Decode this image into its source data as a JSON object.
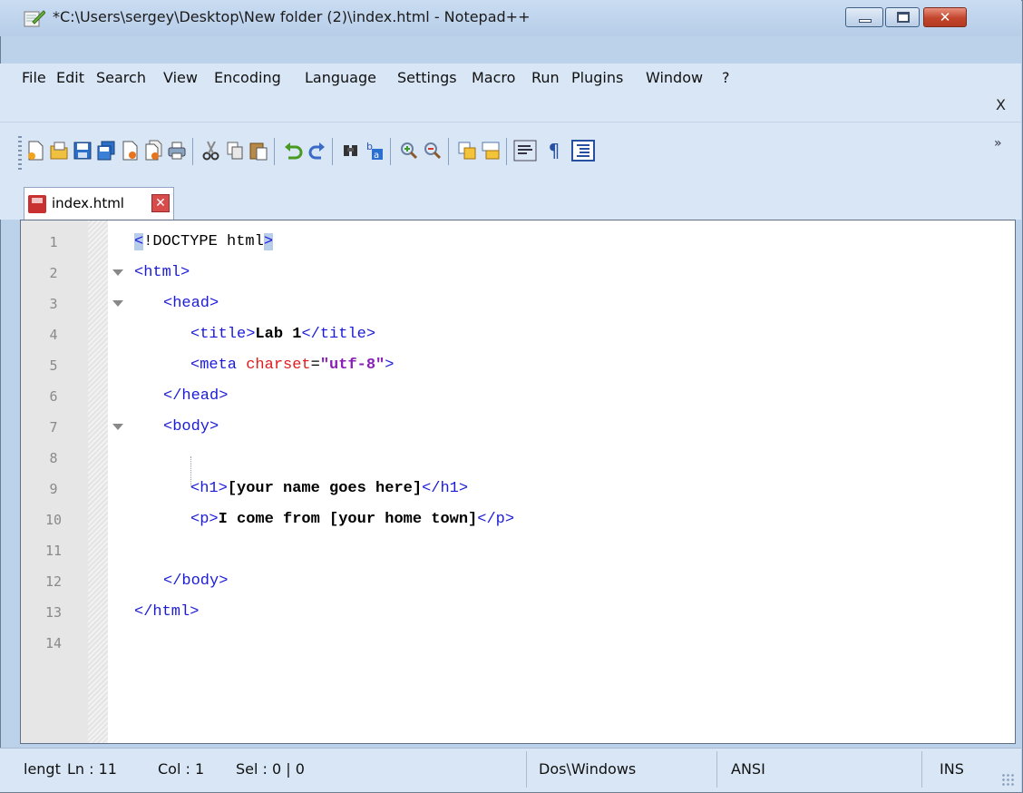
{
  "window": {
    "title": "*C:\\Users\\sergey\\Desktop\\New folder (2)\\index.html - Notepad++",
    "close_glyph": "✕"
  },
  "menu": {
    "items": [
      "File",
      "Edit",
      "Search",
      "View",
      "Encoding",
      "Language",
      "Settings",
      "Macro",
      "Run",
      "Plugins",
      "Window",
      "?"
    ],
    "close_doc": "X"
  },
  "toolbar": {
    "icons": [
      "new-file-icon",
      "open-file-icon",
      "save-icon",
      "save-all-icon",
      "close-icon",
      "close-all-icon",
      "print-icon",
      "cut-icon",
      "copy-icon",
      "paste-icon",
      "undo-icon",
      "redo-icon",
      "find-icon",
      "replace-icon",
      "zoom-in-icon",
      "zoom-out-icon",
      "sync-vertical-icon",
      "sync-horizontal-icon",
      "word-wrap-icon",
      "show-all-chars-icon",
      "indent-guide-icon"
    ],
    "more": "»"
  },
  "tab": {
    "label": "index.html",
    "close": "✕"
  },
  "editor": {
    "line_numbers": [
      "1",
      "2",
      "3",
      "4",
      "5",
      "6",
      "7",
      "8",
      "9",
      "10",
      "11",
      "12",
      "13",
      "14"
    ],
    "lines": {
      "l1_open": "<",
      "l1_doctype": "!DOCTYPE html",
      "l1_close": ">",
      "l2": "<html>",
      "l3": "<head>",
      "l4_open": "<title>",
      "l4_text": "Lab 1",
      "l4_close": "</title>",
      "l5_open": "<meta ",
      "l5_attr": "charset",
      "l5_eq": "=",
      "l5_val": "\"utf-8\"",
      "l5_close": ">",
      "l6": "</head>",
      "l7": "<body>",
      "l9_open": "<h1>",
      "l9_text": "[your name goes here]",
      "l9_close": "</h1>",
      "l10_open": "<p>",
      "l10_text": "I come from [your home town]",
      "l10_close": "</p>",
      "l12": "</body>",
      "l13": "</html>"
    }
  },
  "status": {
    "length": "lengt",
    "ln": "Ln : 11",
    "col": "Col : 1",
    "sel": "Sel : 0 | 0",
    "eol": "Dos\\Windows",
    "encoding": "ANSI",
    "mode": "INS"
  },
  "colors": {
    "tag": "#1b1bd9",
    "attribute": "#e01c1c",
    "attribute_value": "#8a1fb5",
    "brace_highlight": "#b7cdea"
  }
}
